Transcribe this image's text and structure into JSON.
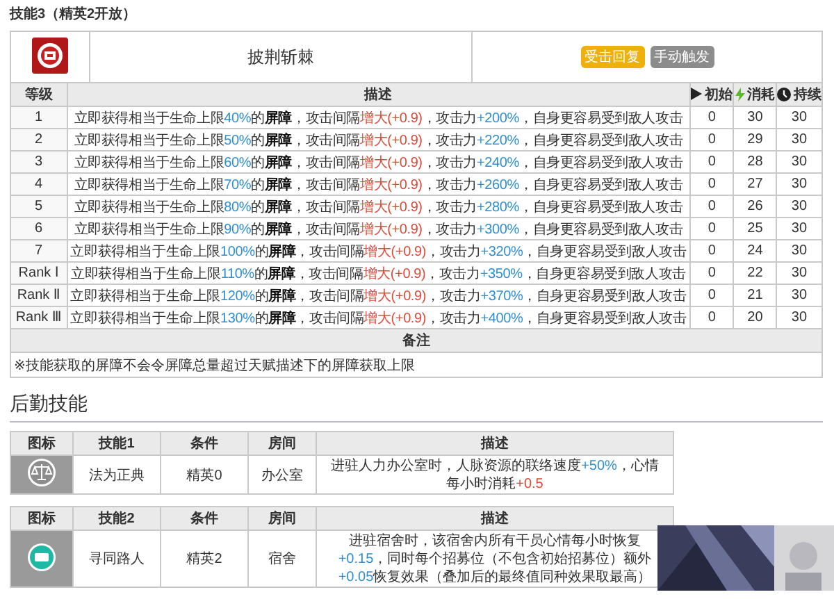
{
  "section_title": "技能3（精英2开放）",
  "skill": {
    "name": "披荆斩棘",
    "tags": [
      {
        "label": "受击回复",
        "color": "#f0b00c"
      },
      {
        "label": "手动触发",
        "color": "#8c8c8c"
      }
    ]
  },
  "level_table": {
    "columns": [
      {
        "label": "等级",
        "kind": "text"
      },
      {
        "label": "描述",
        "kind": "text"
      },
      {
        "label": "初始",
        "kind": "play"
      },
      {
        "label": "消耗",
        "kind": "bolt"
      },
      {
        "label": "持续",
        "kind": "clock"
      }
    ],
    "rows": [
      {
        "level": "1",
        "description": [
          {
            "t": "立即获得相当于生命上限",
            "kind": "text"
          },
          {
            "t": "40%",
            "kind": "value"
          },
          {
            "t": "的",
            "kind": "text"
          },
          {
            "t": "屏障",
            "kind": "term"
          },
          {
            "t": "，攻击间隔",
            "kind": "text"
          },
          {
            "t": "增大(+0.9)",
            "kind": "increase"
          },
          {
            "t": "，攻击力",
            "kind": "text"
          },
          {
            "t": "+200%",
            "kind": "value"
          },
          {
            "t": "，自身更容易受到敌人攻击",
            "kind": "text"
          }
        ],
        "initial": "0",
        "cost": "30",
        "duration": "30"
      },
      {
        "level": "2",
        "description": [
          {
            "t": "立即获得相当于生命上限",
            "kind": "text"
          },
          {
            "t": "50%",
            "kind": "value"
          },
          {
            "t": "的",
            "kind": "text"
          },
          {
            "t": "屏障",
            "kind": "term"
          },
          {
            "t": "，攻击间隔",
            "kind": "text"
          },
          {
            "t": "增大(+0.9)",
            "kind": "increase"
          },
          {
            "t": "，攻击力",
            "kind": "text"
          },
          {
            "t": "+220%",
            "kind": "value"
          },
          {
            "t": "，自身更容易受到敌人攻击",
            "kind": "text"
          }
        ],
        "initial": "0",
        "cost": "29",
        "duration": "30"
      },
      {
        "level": "3",
        "description": [
          {
            "t": "立即获得相当于生命上限",
            "kind": "text"
          },
          {
            "t": "60%",
            "kind": "value"
          },
          {
            "t": "的",
            "kind": "text"
          },
          {
            "t": "屏障",
            "kind": "term"
          },
          {
            "t": "，攻击间隔",
            "kind": "text"
          },
          {
            "t": "增大(+0.9)",
            "kind": "increase"
          },
          {
            "t": "，攻击力",
            "kind": "text"
          },
          {
            "t": "+240%",
            "kind": "value"
          },
          {
            "t": "，自身更容易受到敌人攻击",
            "kind": "text"
          }
        ],
        "initial": "0",
        "cost": "28",
        "duration": "30"
      },
      {
        "level": "4",
        "description": [
          {
            "t": "立即获得相当于生命上限",
            "kind": "text"
          },
          {
            "t": "70%",
            "kind": "value"
          },
          {
            "t": "的",
            "kind": "text"
          },
          {
            "t": "屏障",
            "kind": "term"
          },
          {
            "t": "，攻击间隔",
            "kind": "text"
          },
          {
            "t": "增大(+0.9)",
            "kind": "increase"
          },
          {
            "t": "，攻击力",
            "kind": "text"
          },
          {
            "t": "+260%",
            "kind": "value"
          },
          {
            "t": "，自身更容易受到敌人攻击",
            "kind": "text"
          }
        ],
        "initial": "0",
        "cost": "27",
        "duration": "30"
      },
      {
        "level": "5",
        "description": [
          {
            "t": "立即获得相当于生命上限",
            "kind": "text"
          },
          {
            "t": "80%",
            "kind": "value"
          },
          {
            "t": "的",
            "kind": "text"
          },
          {
            "t": "屏障",
            "kind": "term"
          },
          {
            "t": "，攻击间隔",
            "kind": "text"
          },
          {
            "t": "增大(+0.9)",
            "kind": "increase"
          },
          {
            "t": "，攻击力",
            "kind": "text"
          },
          {
            "t": "+280%",
            "kind": "value"
          },
          {
            "t": "，自身更容易受到敌人攻击",
            "kind": "text"
          }
        ],
        "initial": "0",
        "cost": "26",
        "duration": "30"
      },
      {
        "level": "6",
        "description": [
          {
            "t": "立即获得相当于生命上限",
            "kind": "text"
          },
          {
            "t": "90%",
            "kind": "value"
          },
          {
            "t": "的",
            "kind": "text"
          },
          {
            "t": "屏障",
            "kind": "term"
          },
          {
            "t": "，攻击间隔",
            "kind": "text"
          },
          {
            "t": "增大(+0.9)",
            "kind": "increase"
          },
          {
            "t": "，攻击力",
            "kind": "text"
          },
          {
            "t": "+300%",
            "kind": "value"
          },
          {
            "t": "，自身更容易受到敌人攻击",
            "kind": "text"
          }
        ],
        "initial": "0",
        "cost": "25",
        "duration": "30"
      },
      {
        "level": "7",
        "description": [
          {
            "t": "立即获得相当于生命上限",
            "kind": "text"
          },
          {
            "t": "100%",
            "kind": "value"
          },
          {
            "t": "的",
            "kind": "text"
          },
          {
            "t": "屏障",
            "kind": "term"
          },
          {
            "t": "，攻击间隔",
            "kind": "text"
          },
          {
            "t": "增大(+0.9)",
            "kind": "increase"
          },
          {
            "t": "，攻击力",
            "kind": "text"
          },
          {
            "t": "+320%",
            "kind": "value"
          },
          {
            "t": "，自身更容易受到敌人攻击",
            "kind": "text"
          }
        ],
        "initial": "0",
        "cost": "24",
        "duration": "30"
      },
      {
        "level": "Rank Ⅰ",
        "description": [
          {
            "t": "立即获得相当于生命上限",
            "kind": "text"
          },
          {
            "t": "110%",
            "kind": "value"
          },
          {
            "t": "的",
            "kind": "text"
          },
          {
            "t": "屏障",
            "kind": "term"
          },
          {
            "t": "，攻击间隔",
            "kind": "text"
          },
          {
            "t": "增大(+0.9)",
            "kind": "increase"
          },
          {
            "t": "，攻击力",
            "kind": "text"
          },
          {
            "t": "+350%",
            "kind": "value"
          },
          {
            "t": "，自身更容易受到敌人攻击",
            "kind": "text"
          }
        ],
        "initial": "0",
        "cost": "22",
        "duration": "30"
      },
      {
        "level": "Rank Ⅱ",
        "description": [
          {
            "t": "立即获得相当于生命上限",
            "kind": "text"
          },
          {
            "t": "120%",
            "kind": "value"
          },
          {
            "t": "的",
            "kind": "text"
          },
          {
            "t": "屏障",
            "kind": "term"
          },
          {
            "t": "，攻击间隔",
            "kind": "text"
          },
          {
            "t": "增大(+0.9)",
            "kind": "increase"
          },
          {
            "t": "，攻击力",
            "kind": "text"
          },
          {
            "t": "+370%",
            "kind": "value"
          },
          {
            "t": "，自身更容易受到敌人攻击",
            "kind": "text"
          }
        ],
        "initial": "0",
        "cost": "21",
        "duration": "30"
      },
      {
        "level": "Rank Ⅲ",
        "description": [
          {
            "t": "立即获得相当于生命上限",
            "kind": "text"
          },
          {
            "t": "130%",
            "kind": "value"
          },
          {
            "t": "的",
            "kind": "text"
          },
          {
            "t": "屏障",
            "kind": "term"
          },
          {
            "t": "，攻击间隔",
            "kind": "text"
          },
          {
            "t": "增大(+0.9)",
            "kind": "increase"
          },
          {
            "t": "，攻击力",
            "kind": "text"
          },
          {
            "t": "+400%",
            "kind": "value"
          },
          {
            "t": "，自身更容易受到敌人攻击",
            "kind": "text"
          }
        ],
        "initial": "0",
        "cost": "20",
        "duration": "30"
      }
    ]
  },
  "notes": {
    "heading": "备注",
    "text": "※技能获取的屏障不会令屏障总量超过天赋描述下的屏障获取上限"
  },
  "base_heading": "后勤技能",
  "base_skills": [
    {
      "kind": "scale",
      "columns": [
        "图标",
        "技能1",
        "条件",
        "房间",
        "描述"
      ],
      "name": "法为正典",
      "condition": "精英0",
      "room": "办公室",
      "description": [
        {
          "t": "进驻人力办公室时，人脉资源的联络速度",
          "kind": "text"
        },
        {
          "t": "+50%",
          "kind": "value"
        },
        {
          "t": "，心情每小时消耗",
          "kind": "text"
        },
        {
          "t": "+0.5",
          "kind": "increase"
        }
      ]
    },
    {
      "kind": "badge",
      "columns": [
        "图标",
        "技能2",
        "条件",
        "房间",
        "描述"
      ],
      "name": "寻同路人",
      "condition": "精英2",
      "room": "宿舍",
      "description": [
        {
          "t": "进驻宿舍时，该宿舍内所有干员心情每小时恢复",
          "kind": "text"
        },
        {
          "t": "+0.15",
          "kind": "value"
        },
        {
          "t": "，同时每个招募位（不包含初始招募位）额外",
          "kind": "text"
        },
        {
          "t": "+0.05",
          "kind": "value"
        },
        {
          "t": "恢复效果（叠加后的最终值同种效果取最高）",
          "kind": "text"
        }
      ]
    }
  ]
}
